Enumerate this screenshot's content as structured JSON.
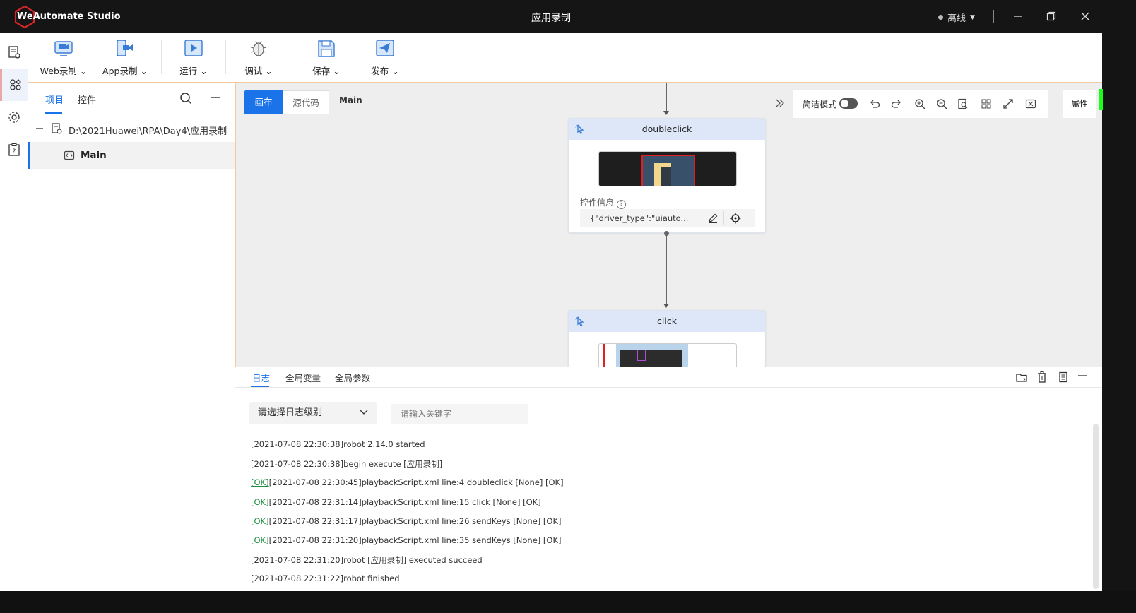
{
  "window": {
    "brand": "WeAutomate Studio",
    "title": "应用录制",
    "status": "离线"
  },
  "toolbar": {
    "web_record": "Web录制",
    "app_record": "App录制",
    "run": "运行",
    "debug": "调试",
    "save": "保存",
    "publish": "发布"
  },
  "panel": {
    "tab_project": "项目",
    "tab_control": "控件",
    "root_path": "D:\\2021Huawei\\RPA\\Day4\\应用录制",
    "main_file": "Main"
  },
  "canvas": {
    "tab_canvas": "画布",
    "tab_source": "源代码",
    "tab_main": "Main",
    "simple_mode": "简洁模式",
    "attributes": "属性",
    "nodes": [
      {
        "title": "doubleclick",
        "control_info_label": "控件信息",
        "control_info_value": "{\"driver_type\":\"uiauto..."
      },
      {
        "title": "click"
      }
    ]
  },
  "log": {
    "tabs": [
      "日志",
      "全局变量",
      "全局参数"
    ],
    "level_placeholder": "请选择日志级别",
    "keyword_placeholder": "请输入关键字",
    "ok_tag": "[OK]",
    "lines": [
      {
        "ok": false,
        "text": "[2021-07-08 22:30:38]robot 2.14.0 started"
      },
      {
        "ok": false,
        "text": "[2021-07-08 22:30:38]begin execute [应用录制]"
      },
      {
        "ok": true,
        "text": "[2021-07-08 22:30:45]playbackScript.xml line:4 doubleclick [None] [OK]"
      },
      {
        "ok": true,
        "text": "[2021-07-08 22:31:14]playbackScript.xml line:15 click [None] [OK]"
      },
      {
        "ok": true,
        "text": "[2021-07-08 22:31:17]playbackScript.xml line:26 sendKeys [None] [OK]"
      },
      {
        "ok": true,
        "text": "[2021-07-08 22:31:20]playbackScript.xml line:35 sendKeys [None] [OK]"
      },
      {
        "ok": false,
        "text": "[2021-07-08 22:31:20]robot [应用录制] executed succeed"
      },
      {
        "ok": false,
        "text": "[2021-07-08 22:31:22]robot finished"
      }
    ]
  },
  "colors": {
    "accent": "#1a73e8",
    "titlebar": "#151515",
    "ok_green": "#1e8e3e",
    "logo_red": "#d6262a"
  }
}
